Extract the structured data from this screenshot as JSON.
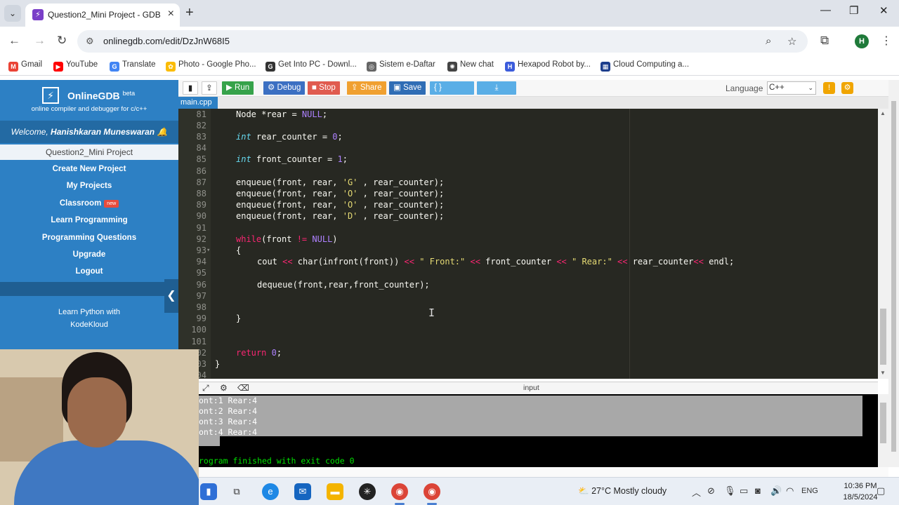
{
  "browser": {
    "tab_title": "Question2_Mini Project - GDB o",
    "url": "onlinegdb.com/edit/DzJnW68I5",
    "profile_initial": "H",
    "bookmarks": [
      {
        "label": "Gmail",
        "icon": "gmail-icon",
        "color": "#ea4335",
        "glyph": "M"
      },
      {
        "label": "YouTube",
        "icon": "youtube-icon",
        "color": "#ff0000",
        "glyph": "▶"
      },
      {
        "label": "Translate",
        "icon": "translate-icon",
        "color": "#4285f4",
        "glyph": "G"
      },
      {
        "label": "Photo - Google Pho...",
        "icon": "photos-icon",
        "color": "#fbbc04",
        "glyph": "✿"
      },
      {
        "label": "Get Into PC - Downl...",
        "icon": "getintopc-icon",
        "color": "#333333",
        "glyph": "G"
      },
      {
        "label": "Sistem e-Daftar",
        "icon": "globe-icon",
        "color": "#666666",
        "glyph": "◎"
      },
      {
        "label": "New chat",
        "icon": "chatgpt-icon",
        "color": "#444444",
        "glyph": "✺"
      },
      {
        "label": "Hexapod Robot by...",
        "icon": "instructables-icon",
        "color": "#3b5bdb",
        "glyph": "H"
      },
      {
        "label": "Cloud Computing a...",
        "icon": "course-icon",
        "color": "#1c3d8c",
        "glyph": "▦"
      }
    ]
  },
  "sidebar": {
    "brand": "OnlineGDB",
    "brand_sup": "beta",
    "tagline": "online compiler and debugger for c/c++",
    "welcome_prefix": "Welcome, ",
    "user_name": "Hanishkaran Muneswaran",
    "project": "Question2_Mini Project",
    "menu": [
      {
        "label": "Create New Project"
      },
      {
        "label": "My Projects"
      },
      {
        "label": "Classroom",
        "badge": "new"
      },
      {
        "label": "Learn Programming"
      },
      {
        "label": "Programming Questions"
      },
      {
        "label": "Upgrade"
      },
      {
        "label": "Logout"
      }
    ],
    "promo_line1": "Learn Python with",
    "promo_line2": "KodeKloud"
  },
  "toolbar": {
    "run": "Run",
    "debug": "Debug",
    "stop": "Stop",
    "share": "Share",
    "save": "Save",
    "beautify": "{ } Beautify",
    "language_label": "Language",
    "language_value": "C++",
    "colors": {
      "run": "#36a24a",
      "debug": "#3b6fc2",
      "stop": "#e05b4f",
      "share": "#f0a030",
      "save": "#2f6db5",
      "beautify": "#5aaee6",
      "download": "#5aaee6"
    }
  },
  "editor": {
    "file_tab": "main.cpp",
    "lines": [
      {
        "n": "81",
        "html": "Node *rear = <span class='n'>NULL</span>;"
      },
      {
        "n": "82",
        "html": ""
      },
      {
        "n": "83",
        "html": "<span class='t'>int</span> rear_counter = <span class='n'>0</span>;"
      },
      {
        "n": "84",
        "html": ""
      },
      {
        "n": "85",
        "html": "<span class='t'>int</span> front_counter = <span class='n'>1</span>;"
      },
      {
        "n": "86",
        "html": ""
      },
      {
        "n": "87",
        "html": "enqueue(front, rear, <span class='s'>'G'</span> , rear_counter);"
      },
      {
        "n": "88",
        "html": "enqueue(front, rear, <span class='s'>'O'</span> , rear_counter);"
      },
      {
        "n": "89",
        "html": "enqueue(front, rear, <span class='s'>'O'</span> , rear_counter);"
      },
      {
        "n": "90",
        "html": "enqueue(front, rear, <span class='s'>'D'</span> , rear_counter);"
      },
      {
        "n": "91",
        "html": ""
      },
      {
        "n": "92",
        "html": "<span class='k'>while</span>(front <span class='k'>!=</span> <span class='n'>NULL</span>)"
      },
      {
        "n": "93",
        "fold": true,
        "html": "{"
      },
      {
        "n": "94",
        "indent": true,
        "html": "cout <span class='k'>&lt;&lt;</span> char(infront(front)) <span class='k'>&lt;&lt;</span> <span class='s'>\" Front:\"</span> <span class='k'>&lt;&lt;</span> front_counter <span class='k'>&lt;&lt;</span> <span class='s'>\" Rear:\"</span> <span class='k'>&lt;&lt;</span> rear_counter<span class='k'>&lt;&lt;</span> endl;"
      },
      {
        "n": "95",
        "html": ""
      },
      {
        "n": "96",
        "indent": true,
        "html": "dequeue(front,rear,front_counter);"
      },
      {
        "n": "97",
        "html": ""
      },
      {
        "n": "98",
        "html": ""
      },
      {
        "n": "99",
        "html": "}"
      },
      {
        "n": "100",
        "html": ""
      },
      {
        "n": "101",
        "html": ""
      },
      {
        "n": "102",
        "html": "<span class='k'>return</span> <span class='n'>0</span>;"
      },
      {
        "n": "103",
        "outdent": true,
        "html": "}"
      },
      {
        "n": "104",
        "html": ""
      }
    ]
  },
  "console": {
    "input_label": "input",
    "output": [
      "ont:1 Rear:4",
      "ont:2 Rear:4",
      "ont:3 Rear:4",
      "ont:4 Rear:4"
    ],
    "exit_message": "rogram finished with exit code 0"
  },
  "taskbar": {
    "weather": "27°C  Mostly cloudy",
    "lang": "ENG",
    "time": "10:36 PM",
    "date": "18/5/2024"
  }
}
